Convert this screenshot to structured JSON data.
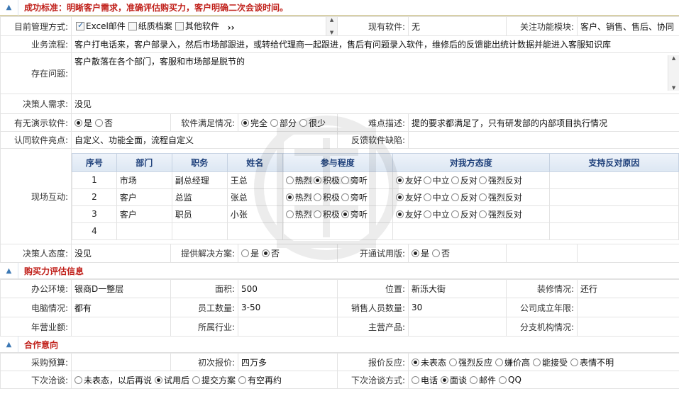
{
  "sections": {
    "success_title": "成功标准：明晰客户需求，准确评估购买力，客户明确二次会谈时间。",
    "purchasing_title": "购买力评估信息",
    "cooperation_title": "合作意向"
  },
  "form": {
    "mgmt_label": "目前管理方式:",
    "mgmt_options": [
      "Excel邮件",
      "纸质档案",
      "其他软件"
    ],
    "mgmt_checked": [
      true,
      false,
      false
    ],
    "mgmt_more": "››",
    "existing_label": "现有软件:",
    "existing_value": "无",
    "focus_label": "关注功能模块:",
    "focus_value": "客户、销售、售后、协同",
    "process_label": "业务流程:",
    "process_value": "客户打电话来，客户部录入，然后市场部跟进，或转给代理商一起跟进，售后有问题录入软件，维修后的反馈能出统计数据并能进入客服知识库",
    "problem_label": "存在问题:",
    "problem_value": "客户散落在各个部门，客服和市场部是脱节的",
    "decision_need_label": "决策人需求:",
    "decision_need_value": "没见",
    "demo_label": "有无演示软件:",
    "demo_options": [
      "是",
      "否"
    ],
    "demo_selected": 0,
    "satisfy_label": "软件满足情况:",
    "satisfy_options": [
      "完全",
      "部分",
      "很少"
    ],
    "satisfy_selected": 0,
    "difficulty_label": "难点描述:",
    "difficulty_value": "提的要求都满足了，只有研发部的内部项目执行情况",
    "highlight_label": "认同软件亮点:",
    "highlight_value": "自定义、功能全面，流程自定义",
    "defect_label": "反馈软件缺陷:",
    "defect_value": "",
    "interaction_label": "现场互动:",
    "decision_attitude_label": "决策人态度:",
    "decision_attitude_value": "没见",
    "solution_label": "提供解决方案:",
    "solution_options": [
      "是",
      "否"
    ],
    "solution_selected": 1,
    "trial_label": "开通试用版:",
    "trial_options": [
      "是",
      "否"
    ],
    "trial_selected": 0
  },
  "interaction": {
    "headers": [
      "序号",
      "部门",
      "职务",
      "姓名",
      "参与程度",
      "对我方态度",
      "支持反对原因"
    ],
    "participation_options": [
      "热烈",
      "积极",
      "旁听"
    ],
    "attitude_options": [
      "友好",
      "中立",
      "反对",
      "强烈反对"
    ],
    "rows": [
      {
        "no": "1",
        "dept": "市场",
        "title": "副总经理",
        "name": "王总",
        "participation": 1,
        "attitude": 0,
        "reason": ""
      },
      {
        "no": "2",
        "dept": "客户",
        "title": "总监",
        "name": "张总",
        "participation": 0,
        "attitude": 0,
        "reason": ""
      },
      {
        "no": "3",
        "dept": "客户",
        "title": "职员",
        "name": "小张",
        "participation": 2,
        "attitude": 0,
        "reason": ""
      },
      {
        "no": "4",
        "dept": "",
        "title": "",
        "name": "",
        "participation": -1,
        "attitude": -1,
        "reason": ""
      }
    ]
  },
  "purchasing": {
    "office_label": "办公环境:",
    "office_value": "银商D一整层",
    "area_label": "面积:",
    "area_value": "500",
    "location_label": "位置:",
    "location_value": "新泺大街",
    "decor_label": "装修情况:",
    "decor_value": "还行",
    "pc_label": "电脑情况:",
    "pc_value": "都有",
    "staff_label": "员工数量:",
    "staff_value": "3-50",
    "sales_label": "销售人员数量:",
    "sales_value": "30",
    "founded_label": "公司成立年限:",
    "founded_value": "",
    "revenue_label": "年营业额:",
    "revenue_value": "",
    "industry_label": "所属行业:",
    "industry_value": "",
    "product_label": "主营产品:",
    "product_value": "",
    "branch_label": "分支机构情况:",
    "branch_value": ""
  },
  "cooperation": {
    "budget_label": "采购预算:",
    "budget_value": "",
    "quote_label": "初次报价:",
    "quote_value": "四万多",
    "reaction_label": "报价反应:",
    "reaction_options": [
      "未表态",
      "强烈反应",
      "嫌价高",
      "能接受",
      "表情不明"
    ],
    "reaction_selected": 0,
    "next_label": "下次洽谈:",
    "next_options": [
      "未表态，以后再说",
      "试用后",
      "提交方案",
      "有空再约"
    ],
    "next_selected": 1,
    "method_label": "下次洽谈方式:",
    "method_options": [
      "电话",
      "面谈",
      "邮件",
      "QQ"
    ],
    "method_selected": 1
  },
  "icons": {
    "collapse": "chevron-up-icon",
    "scroll_up": "scroll-up-icon",
    "scroll_down": "scroll-down-icon"
  },
  "colors": {
    "section_title": "#c0201a",
    "header_text": "#1d3f7a",
    "header_bg": "#dde7f3"
  }
}
